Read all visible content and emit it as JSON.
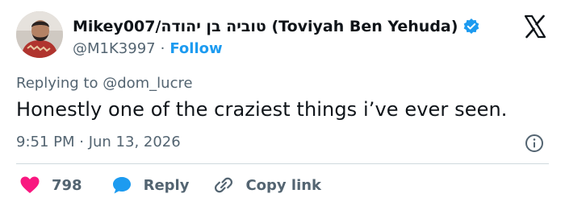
{
  "author": {
    "display_name": "Mikey007/טוביה בן יהודה (Toviyah Ben Yehuda)",
    "handle": "@M1K3997",
    "separator": "·",
    "follow_label": "Follow",
    "verified": true
  },
  "reply_context": {
    "prefix": "Replying to ",
    "mention": "@dom_lucre"
  },
  "tweet": {
    "text": "Honestly one of the craziest things i’ve ever seen.",
    "timestamp": "9:51 PM · Jun 13, 2026"
  },
  "actions": {
    "likes": "798",
    "reply_label": "Reply",
    "copy_link_label": "Copy link"
  },
  "colors": {
    "accent": "#1d9bf0",
    "like": "#f91880",
    "text_primary": "#0f1419",
    "text_secondary": "#536471",
    "divider": "#cfd9de"
  },
  "icons": {
    "logo": "x-logo-icon",
    "verified": "verified-badge-icon",
    "info": "info-icon",
    "like": "heart-icon",
    "reply": "speech-bubble-icon",
    "copy": "link-icon"
  }
}
